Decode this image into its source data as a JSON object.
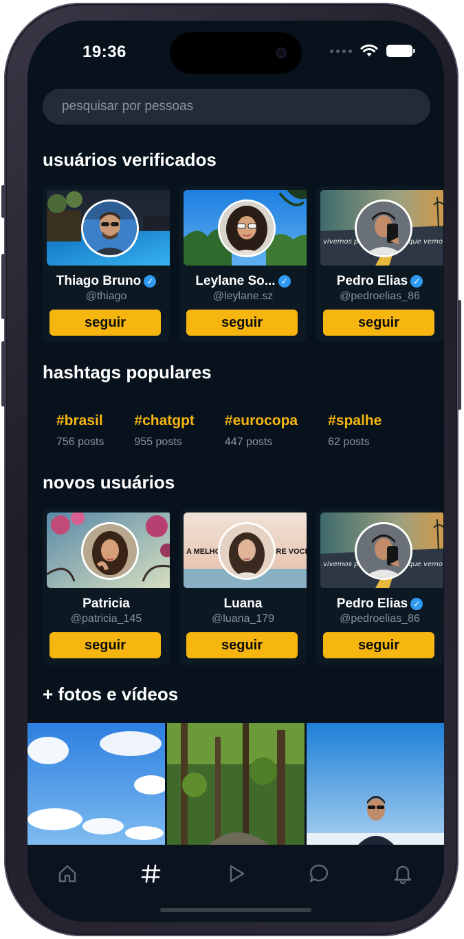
{
  "status_bar": {
    "time": "19:36"
  },
  "search": {
    "placeholder": "pesquisar por pessoas"
  },
  "sections": {
    "verified": "usuários verificados",
    "hashtags": "hashtags populares",
    "new_users": "novos usuários",
    "media": "+ fotos e vídeos"
  },
  "verified_users": [
    {
      "name": "Thiago Bruno",
      "handle": "@thiago",
      "verified": true,
      "button": "seguir"
    },
    {
      "name": "Leylane So...",
      "handle": "@leylane.sz",
      "verified": true,
      "button": "seguir"
    },
    {
      "name": "Pedro Elias",
      "handle": "@pedroelias_86",
      "verified": true,
      "button": "seguir",
      "banner_text_left": "vivemos p",
      "banner_text_right": "que vemo"
    }
  ],
  "hashtags": [
    {
      "tag": "#brasil",
      "count": "756 posts"
    },
    {
      "tag": "#chatgpt",
      "count": "955 posts"
    },
    {
      "tag": "#eurocopa",
      "count": "447 posts"
    },
    {
      "tag": "#spalhe",
      "count": "62 posts"
    }
  ],
  "new_users": [
    {
      "name": "Patricia",
      "handle": "@patricia_145",
      "verified": false,
      "button": "seguir"
    },
    {
      "name": "Luana",
      "handle": "@luana_179",
      "verified": false,
      "button": "seguir",
      "banner_text_left": "A MELHOR",
      "banner_text_right": "IPRE VOCÊ."
    },
    {
      "name": "Pedro Elias",
      "handle": "@pedroelias_86",
      "verified": true,
      "button": "seguir",
      "banner_text_left": "vivemos p",
      "banner_text_right": "que vemo"
    }
  ],
  "tabbar": {
    "items": [
      {
        "icon": "home-icon"
      },
      {
        "icon": "hashtag-icon",
        "active": true
      },
      {
        "icon": "play-icon"
      },
      {
        "icon": "chat-bubble-icon"
      },
      {
        "icon": "bell-icon"
      }
    ]
  },
  "colors": {
    "accent": "#f6b60f",
    "background": "#07121c",
    "verified": "#2f9af2"
  }
}
